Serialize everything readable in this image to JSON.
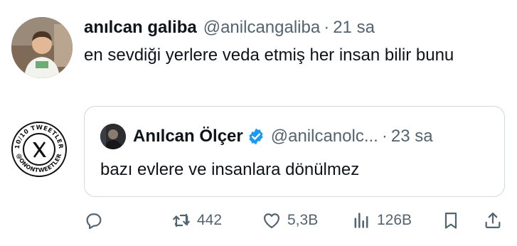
{
  "tweet": {
    "author_name": "anılcan galiba",
    "author_handle": "@anilcangaliba",
    "separator": "·",
    "time": "21 sa",
    "text": "en sevdiği yerlere veda etmiş her insan bilir bunu"
  },
  "quoted_tweet": {
    "author_name": "Anılcan Ölçer",
    "author_handle": "@anilcanolc...",
    "separator": "·",
    "time": "23 sa",
    "text": "bazı evlere ve insanlara dönülmez",
    "verified": true
  },
  "watermark": {
    "top_text": "10/10 TWEETLER",
    "bottom_text": "@ONONTWEETLER",
    "icon": "x-logo-icon"
  },
  "actions": {
    "reply": {
      "icon": "reply-icon",
      "count": ""
    },
    "retweet": {
      "icon": "retweet-icon",
      "count": "442"
    },
    "like": {
      "icon": "heart-icon",
      "count": "5,3B"
    },
    "views": {
      "icon": "views-icon",
      "count": "126B"
    },
    "bookmark": {
      "icon": "bookmark-icon"
    },
    "share": {
      "icon": "share-icon"
    }
  },
  "colors": {
    "text_primary": "#0f1419",
    "text_secondary": "#536471",
    "border": "#cfd9de",
    "verified_blue": "#1d9bf0"
  }
}
